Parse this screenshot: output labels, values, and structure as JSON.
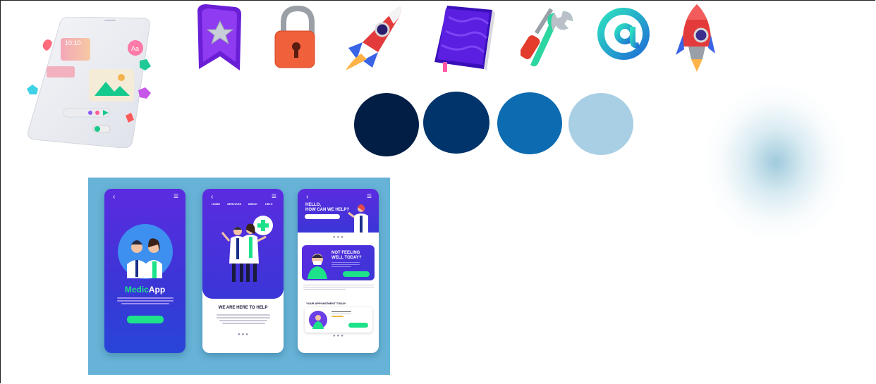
{
  "icons": [
    {
      "name": "bookmark-star-icon"
    },
    {
      "name": "padlock-icon"
    },
    {
      "name": "rocket-icon"
    },
    {
      "name": "notebook-icon"
    },
    {
      "name": "tools-icon"
    },
    {
      "name": "at-sign-icon"
    },
    {
      "name": "rocket-front-icon"
    }
  ],
  "palette": [
    "#021e45",
    "#01346b",
    "#0d6bb1",
    "#a8cfe3"
  ],
  "phone_illustration": {
    "clock": "10:10",
    "badge": "Aa"
  },
  "mockup": {
    "screen1": {
      "brand_prefix": "Medic",
      "brand_suffix": "App"
    },
    "screen2": {
      "nav": [
        "HOME",
        "SERVICES",
        "MEDIC",
        "HELP"
      ],
      "headline": "WE ARE HERE TO HELP"
    },
    "screen3": {
      "greeting_line1": "HELLO,",
      "greeting_line2": "HOW CAN WE HELP?",
      "card_title_line1": "NOT FEELING",
      "card_title_line2": "WELL TODAY?",
      "section_title": "YOUR APPOINTMENT TODAY"
    }
  }
}
